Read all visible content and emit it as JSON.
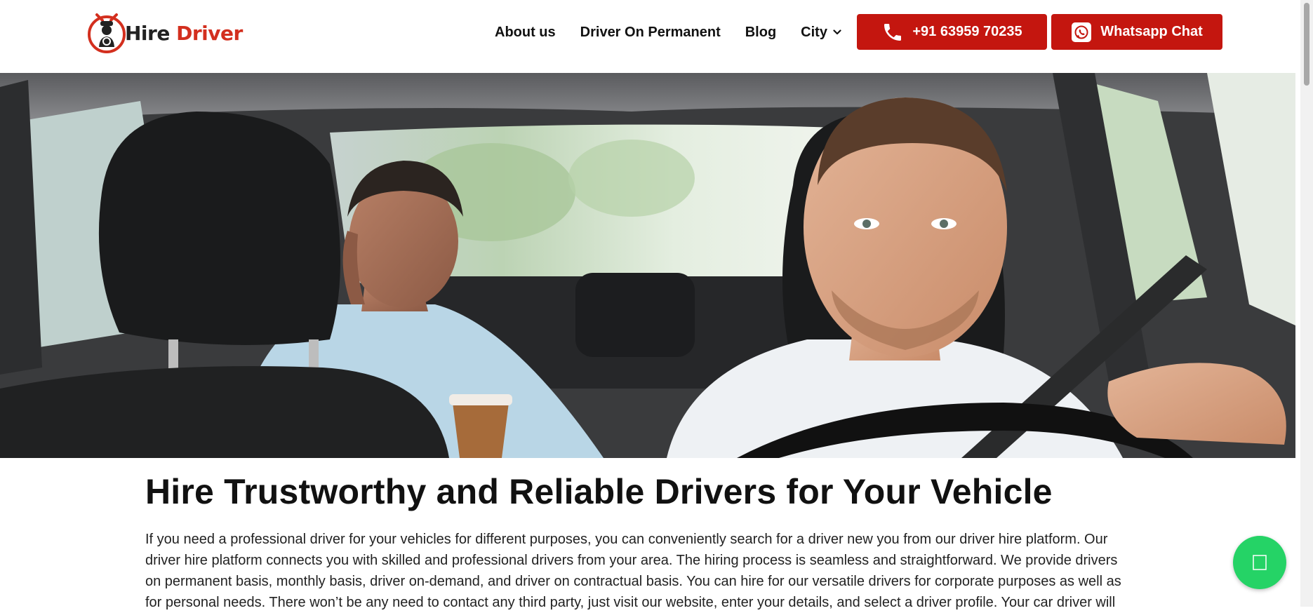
{
  "logo": {
    "word1": "Hire",
    "word2": "Driver"
  },
  "nav": {
    "about": "About us",
    "permanent": "Driver On Permanent",
    "blog": "Blog",
    "city": "City"
  },
  "buttons": {
    "phone": "+91 63959 70235",
    "whatsapp": "Whatsapp Chat"
  },
  "main": {
    "title": "Hire Trustworthy and Reliable Drivers for Your Vehicle",
    "paragraph": "If you need a professional driver for your vehicles for different purposes, you can conveniently search for a driver new you from our driver hire platform. Our driver hire platform connects you with skilled and professional drivers from your area. The hiring process is seamless and straightforward. We provide drivers on permanent basis, monthly basis, driver on-demand, and driver on contractual basis. You can hire for our versatile drivers for corporate purposes as well as for personal needs. There won’t be any need to contact any third party, just visit our website, enter your details, and select a driver profile. Your car driver will"
  },
  "colors": {
    "brand_red": "#c4160f",
    "whatsapp_green": "#25d366"
  },
  "icons": [
    "phone-icon",
    "whatsapp-icon",
    "chevron-down-icon",
    "chat-icon"
  ]
}
